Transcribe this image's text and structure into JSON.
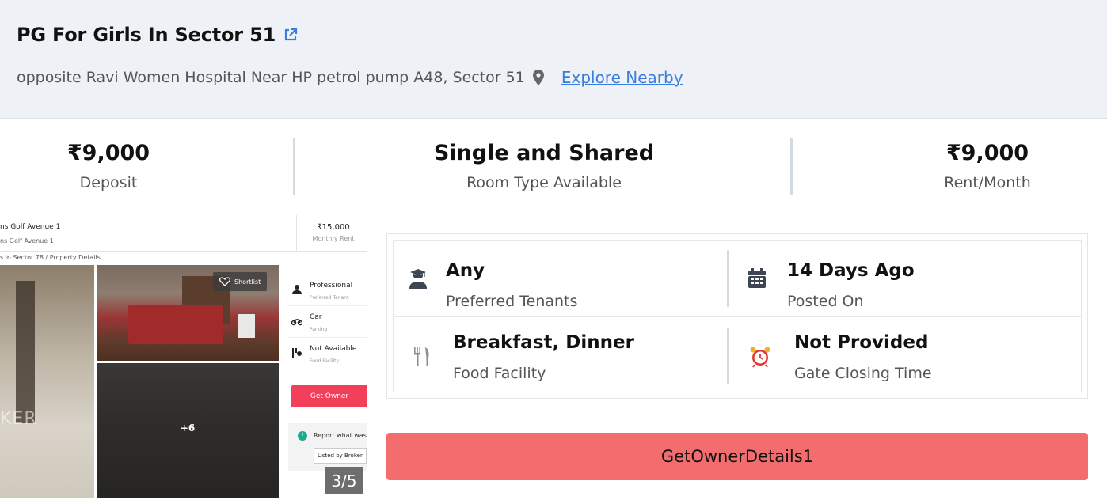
{
  "header": {
    "title": "PG For Girls In Sector 51",
    "address": "opposite Ravi Women Hospital Near HP petrol pump A48, Sector 51",
    "explore_label": "Explore Nearby",
    "link_color": "#3b7ddd"
  },
  "stats": [
    {
      "value": "₹9,000",
      "label": "Deposit"
    },
    {
      "value": "Single and Shared",
      "label": "Room Type Available"
    },
    {
      "value": "₹9,000",
      "label": "Rent/Month"
    }
  ],
  "gallery": {
    "listing_name": "ns Golf Avenue 1",
    "listing_sub": "ns Golf Avenue 1",
    "price": "₹15,000",
    "price_label": "Monthly Rent",
    "breadcrumb": "s in Sector 78 / Property Details",
    "shortlist_label": "Shortlist",
    "more_photos": "+6",
    "watermark": "KER",
    "side_items": [
      {
        "title": "Professional",
        "sub": "Preferred Tenant",
        "icon": "person-icon"
      },
      {
        "title": "Car",
        "sub": "Parking",
        "icon": "bike-icon"
      },
      {
        "title": "Not Available",
        "sub": "Food Facility",
        "icon": "food-icon"
      }
    ],
    "owner_button": "Get Owner",
    "report_label": "Report what was",
    "listed_by": "Listed by Broker",
    "counter": "3/5"
  },
  "details": [
    {
      "value": "Any",
      "label": "Preferred Tenants",
      "icon": "graduate-user-icon"
    },
    {
      "value": "14 Days Ago",
      "label": "Posted On",
      "icon": "calendar-icon"
    },
    {
      "value": "Breakfast, Dinner",
      "label": "Food Facility",
      "icon": "fork-knife-icon"
    },
    {
      "value": "Not Provided",
      "label": "Gate Closing Time",
      "icon": "alarm-clock-icon"
    }
  ],
  "cta": {
    "label": "GetOwnerDetails1",
    "color": "#f36d6f"
  }
}
